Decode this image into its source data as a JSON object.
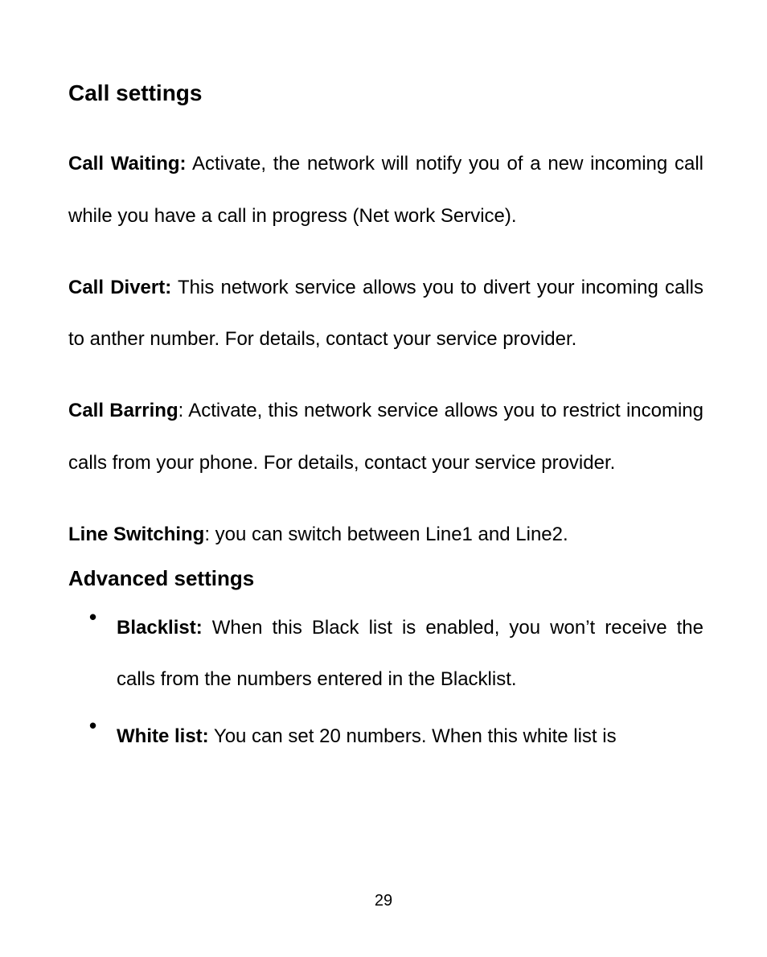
{
  "heading": "Call settings",
  "paragraphs": {
    "call_waiting": {
      "label": "Call Waiting:",
      "text": " Activate, the network will notify you of a new incoming call while you have a call in progress (Net work Service)."
    },
    "call_divert": {
      "label": "Call Divert:",
      "text": " This network service allows you to divert your incoming calls to anther number. For details, contact your service provider."
    },
    "call_barring": {
      "label": "Call Barring",
      "text": ": Activate, this network service allows you to restrict incoming calls from your phone. For details, contact your service provider."
    },
    "line_switching": {
      "label": "Line Switching",
      "text": ": you can switch between Line1 and Line2."
    }
  },
  "subheading": "Advanced settings",
  "bullets": {
    "blacklist": {
      "label": "Blacklist:",
      "text": " When this Black list is enabled, you won’t receive the calls from the numbers entered in the Blacklist."
    },
    "whitelist": {
      "label": "White list:",
      "text": " You can set 20 numbers. When this white list is"
    }
  },
  "page_number": "29"
}
